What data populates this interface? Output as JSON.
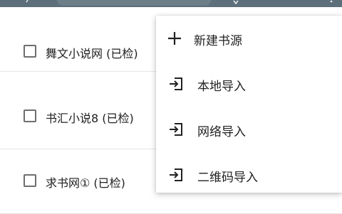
{
  "toolbar": {
    "search_icon": "search-icon",
    "sort_icon": "sort-icon",
    "more_icon": "more-vert-icon"
  },
  "sources": [
    {
      "label": "舞文小说网 (已检)",
      "checked": false
    },
    {
      "label": "书汇小说8 (已检)",
      "checked": false
    },
    {
      "label": "求书网① (已检)",
      "checked": false
    }
  ],
  "menu": {
    "items": [
      {
        "label": "新建书源",
        "icon": "add-icon"
      },
      {
        "label": "本地导入",
        "icon": "import-icon"
      },
      {
        "label": "网络导入",
        "icon": "import-icon"
      },
      {
        "label": "二维码导入",
        "icon": "import-icon"
      }
    ]
  },
  "colors": {
    "toolbar": "#5c6f7a",
    "menu_bg": "#ffffff",
    "checkbox_border": "#6e6e6e"
  }
}
